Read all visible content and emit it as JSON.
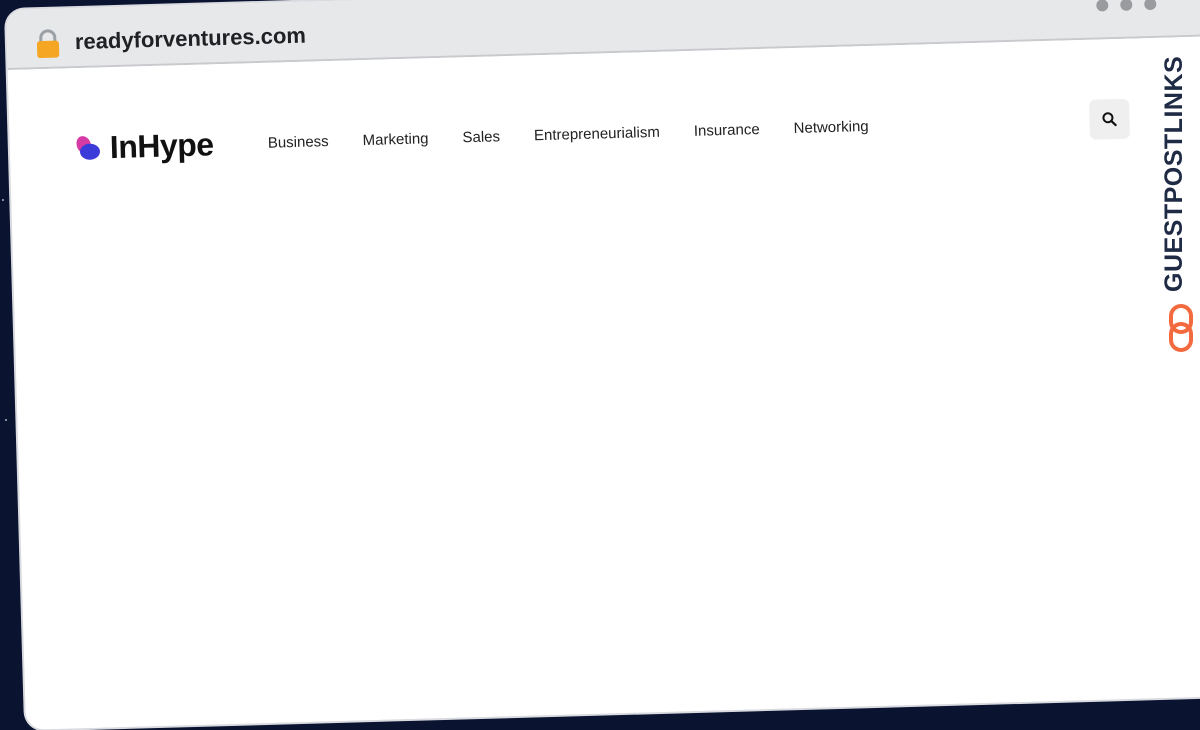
{
  "browser": {
    "url": "readyforventures.com",
    "lock_icon": "lock-icon",
    "window_dots": [
      "dot",
      "dot",
      "dot"
    ]
  },
  "site": {
    "logo_text": "InHype",
    "nav": [
      {
        "label": "Business"
      },
      {
        "label": "Marketing"
      },
      {
        "label": "Sales"
      },
      {
        "label": "Entrepreneurialism"
      },
      {
        "label": "Insurance"
      },
      {
        "label": "Networking"
      }
    ],
    "search_icon": "search-icon"
  },
  "watermark": {
    "text": "GUESTPOSTLINKS",
    "icon": "chain-link-icon"
  },
  "colors": {
    "lock": "#f5a623",
    "logo_pink": "#d63aa5",
    "logo_blue": "#3b3bd9",
    "brand_orange": "#f26a3d",
    "brand_dark": "#1f2a44"
  }
}
